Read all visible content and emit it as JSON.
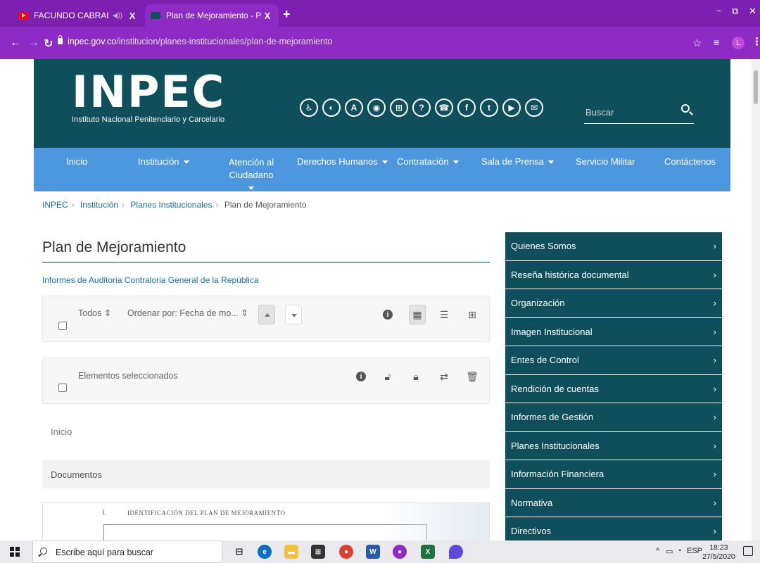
{
  "browser": {
    "tabs": [
      {
        "title": "FACUNDO CABRAL MONOLO",
        "active": false
      },
      {
        "title": "Plan de Mejoramiento - Plan de I",
        "active": true
      }
    ],
    "tab_close": "X",
    "new_tab": "+",
    "url_domain": "inpec.gov.co",
    "url_path": "/institucion/planes-institucionales/plan-de-mejoramiento",
    "profile_initial": "L",
    "window_controls": [
      "−",
      "⧉",
      "✕"
    ]
  },
  "site": {
    "logo_text": "INPEC",
    "logo_subtitle": "Instituto Nacional Penitenciario y Carcelario",
    "social_icons": [
      "accessibility-icon",
      "contrast-icon",
      "font-size-icon",
      "rss-icon",
      "sitemap-icon",
      "help-icon",
      "support-icon",
      "facebook-icon",
      "twitter-icon",
      "youtube-icon",
      "mail-icon"
    ],
    "social_glyphs": [
      "♿",
      "◐",
      "A",
      "◉",
      "⊞",
      "?",
      "☎",
      "f",
      "t",
      "▶",
      "✉"
    ],
    "search_placeholder": "Buscar",
    "nav": [
      {
        "label": "Inicio",
        "dropdown": false
      },
      {
        "label": "Institución",
        "dropdown": true
      },
      {
        "label": "Atención al Ciudadano",
        "dropdown": true
      },
      {
        "label": "Derechos Humanos",
        "dropdown": true
      },
      {
        "label": "Contratación",
        "dropdown": true
      },
      {
        "label": "Sala de Prensa",
        "dropdown": true
      },
      {
        "label": "Servicio Militar",
        "dropdown": false
      },
      {
        "label": "Contáctenos",
        "dropdown": false
      }
    ]
  },
  "breadcrumb": [
    "INPEC",
    "Institución",
    "Planes Institucionales",
    "Plan de Mejoramiento"
  ],
  "main": {
    "title": "Plan de Mejoramiento",
    "sublink": "Informes de Auditoria Contraloria General de la República",
    "filter": {
      "all_label": "Todos",
      "sort_label": "Ordenar por: Fecha de mo..."
    },
    "selection_label": "Elementos seleccionados",
    "inicio_label": "Inicio",
    "documents_label": "Documentos",
    "doc_preview": {
      "number": "I.",
      "heading": "IDENTIFICACIÓN DEL PLAN DE MEJORAMIENTO"
    }
  },
  "sidebar": {
    "items": [
      "Quienes Somos",
      "Reseña histórica documental",
      "Organización",
      "Imagen Institucional",
      "Entes de Control",
      "Rendición de cuentas",
      "Informes de Gestión",
      "Planes Institucionales",
      "Información Financiera",
      "Normativa",
      "Directivos"
    ]
  },
  "taskbar": {
    "search_placeholder": "Escribe aquí para buscar",
    "lang": "ESP",
    "time": "18:23",
    "date": "27/5/2020"
  },
  "colors": {
    "chrome": "#8e2bc4",
    "header": "#0f4f5b",
    "nav": "#4c97dd",
    "sidebar": "#0f4f5b",
    "link": "#1a6ea8"
  }
}
